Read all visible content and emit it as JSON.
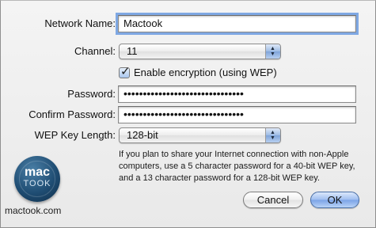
{
  "form": {
    "network_name": {
      "label": "Network Name:",
      "value": "Mactook"
    },
    "channel": {
      "label": "Channel:",
      "value": "11"
    },
    "encryption": {
      "label": "Enable encryption (using WEP)",
      "checked": true
    },
    "password": {
      "label": "Password:",
      "value": "•••••••••••••••••••••••••••••••"
    },
    "confirm_password": {
      "label": "Confirm Password:",
      "value": "•••••••••••••••••••••••••••••••"
    },
    "wep_key_length": {
      "label": "WEP Key Length:",
      "value": "128-bit"
    }
  },
  "help": {
    "line1": "If you plan to share your Internet connection with non-Apple",
    "line2": "computers, use a 5 character password for a 40-bit WEP key,",
    "line3": "and a 13 character password for a 128-bit WEP key."
  },
  "buttons": {
    "cancel": "Cancel",
    "ok": "OK"
  },
  "logo": {
    "top": "mac",
    "bottom": "TOOK"
  },
  "brand": "mactook.com",
  "icons": {
    "stepper": "up-down-arrows-icon",
    "check": "checkmark-icon"
  },
  "colors": {
    "focus_ring": "#7fa8e3",
    "default_button": "#9dbdf0",
    "logo": "#1f4d73"
  }
}
